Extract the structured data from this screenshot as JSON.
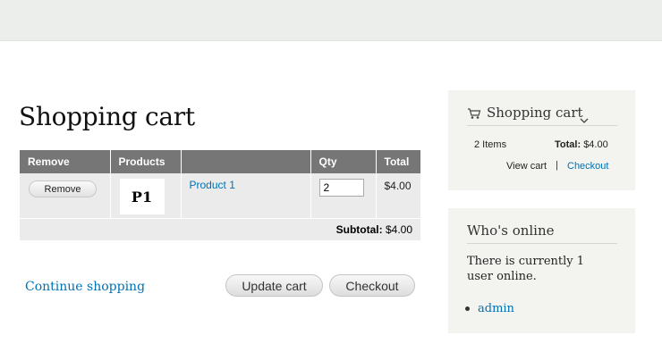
{
  "page": {
    "title": "Shopping cart"
  },
  "cart_table": {
    "headers": {
      "remove": "Remove",
      "products": "Products",
      "qty": "Qty",
      "total": "Total"
    },
    "items": [
      {
        "remove_label": "Remove",
        "thumbnail": "P1",
        "product": "Product 1",
        "qty": "2",
        "total": "$4.00"
      }
    ],
    "subtotal_label": "Subtotal:",
    "subtotal_value": "$4.00"
  },
  "actions": {
    "continue": "Continue shopping",
    "update": "Update cart",
    "checkout": "Checkout"
  },
  "cart_block": {
    "title": "Shopping cart",
    "items_count": "2 Items",
    "total_label": "Total:",
    "total_value": "$4.00",
    "view_cart": "View cart",
    "separator": "|",
    "checkout": "Checkout"
  },
  "online_block": {
    "title": "Who's online",
    "text": "There is currently 1 user online.",
    "users": [
      "admin"
    ]
  },
  "icons": {
    "cart": "cart-icon",
    "chevron": "chevron-down-icon"
  }
}
